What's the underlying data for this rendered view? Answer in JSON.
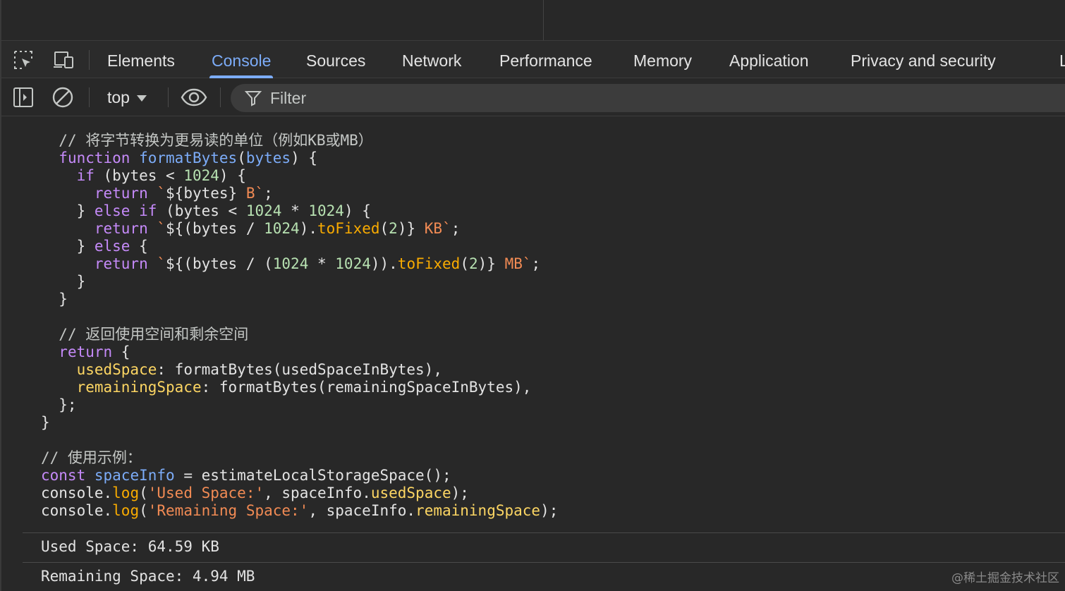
{
  "tabs": [
    "Elements",
    "Console",
    "Sources",
    "Network",
    "Performance",
    "Memory",
    "Application",
    "Privacy and security",
    "L"
  ],
  "active_tab": "Console",
  "toolbar": {
    "context": "top",
    "filter_placeholder": "Filter"
  },
  "icons": {
    "inspect": "inspect-element-icon",
    "device": "device-toolbar-icon",
    "sidebar": "show-sidebar-icon",
    "clear": "clear-console-icon",
    "eye": "live-expression-icon",
    "filter": "filter-icon"
  },
  "code": {
    "l1_comment": "// 将字节转换为更易读的单位（例如KB或MB）",
    "l2_function": "function",
    "l2_name": "formatBytes",
    "l2_param": "bytes",
    "l3_if": "if",
    "l3_bytes": "bytes",
    "l3_num": "1024",
    "l4_return": "return",
    "l4_bytes": "bytes",
    "l4_unit": " B",
    "l5_else": "else",
    "l5_if": "if",
    "l5_bytes": "bytes",
    "l5_num1": "1024",
    "l5_num2": "1024",
    "l6_return": "return",
    "l6_bytes": "bytes",
    "l6_num": "1024",
    "l6_tofixed": "toFixed",
    "l6_arg": "2",
    "l6_unit": " KB",
    "l7_else": "else",
    "l8_return": "return",
    "l8_bytes": "bytes",
    "l8_num1": "1024",
    "l8_num2": "1024",
    "l8_tofixed": "toFixed",
    "l8_arg": "2",
    "l8_unit": " MB",
    "l12_comment": "// 返回使用空间和剩余空间",
    "l13_return": "return",
    "l14_key": "usedSpace",
    "l14_value": "formatBytes(usedSpaceInBytes)",
    "l15_key": "remainingSpace",
    "l15_value": "formatBytes(remainingSpaceInBytes)",
    "l19_comment": "// 使用示例：",
    "l20_const": "const",
    "l20_name": "spaceInfo",
    "l20_rest": " = estimateLocalStorageSpace();",
    "l21_console": "console.",
    "l21_log": "log",
    "l21_str": "'Used Space:'",
    "l21_obj": ", spaceInfo.",
    "l21_prop": "usedSpace",
    "l22_console": "console.",
    "l22_log": "log",
    "l22_str": "'Remaining Space:'",
    "l22_obj": ", spaceInfo.",
    "l22_prop": "remainingSpace"
  },
  "output": [
    "Used Space: 64.59 KB",
    "Remaining Space: 4.94 MB"
  ],
  "watermark": "@稀土掘金技术社区"
}
